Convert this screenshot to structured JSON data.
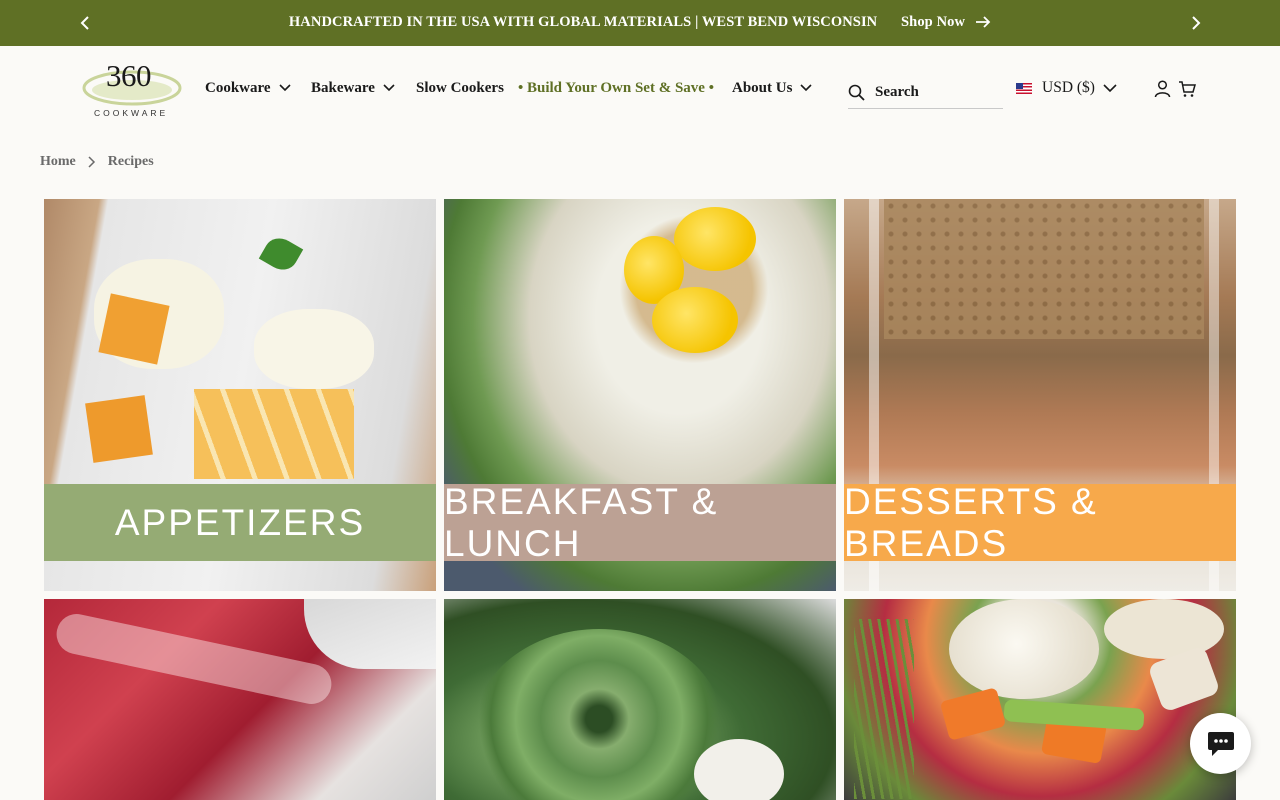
{
  "announcement": {
    "message": "HANDCRAFTED IN THE USA WITH GLOBAL MATERIALS | WEST BEND WISCONSIN",
    "cta": "Shop Now"
  },
  "brand": {
    "logo_number": "360",
    "logo_word": "COOKWARE"
  },
  "nav": {
    "items": [
      {
        "label": "Cookware",
        "has_dropdown": true
      },
      {
        "label": "Bakeware",
        "has_dropdown": true
      },
      {
        "label": "Slow Cookers",
        "has_dropdown": false
      },
      {
        "label": "• Build Your Own Set & Save •",
        "has_dropdown": false
      },
      {
        "label": "About Us",
        "has_dropdown": true
      }
    ]
  },
  "search": {
    "label": "Search"
  },
  "currency": {
    "label": "USD ($)"
  },
  "breadcrumb": {
    "home": "Home",
    "current": "Recipes"
  },
  "categories": [
    {
      "label": "APPETIZERS",
      "band_color": "#95ab74"
    },
    {
      "label": "BREAKFAST & LUNCH",
      "band_color": "#bca194"
    },
    {
      "label": "DESSERTS & BREADS",
      "band_color": "#f7a94b"
    },
    {
      "label": "",
      "band_color": ""
    },
    {
      "label": "",
      "band_color": ""
    },
    {
      "label": "",
      "band_color": ""
    }
  ],
  "colors": {
    "accent": "#5f7025",
    "background": "#fbfaf7"
  },
  "icons": [
    "chevron-left-icon",
    "chevron-right-icon",
    "arrow-right-icon",
    "search-icon",
    "us-flag-icon",
    "account-icon",
    "cart-icon",
    "chat-icon"
  ]
}
